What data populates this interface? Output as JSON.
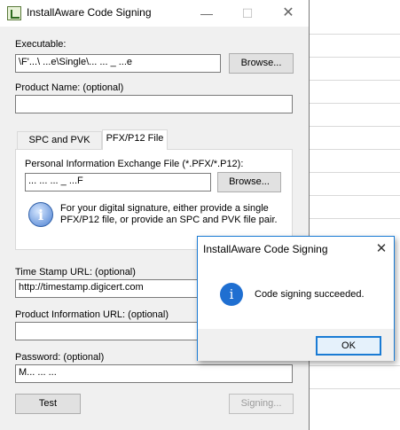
{
  "window": {
    "title": "InstallAware Code Signing",
    "minimize_glyph": "—",
    "maximize_glyph": "☐",
    "close_glyph": "✕"
  },
  "executable": {
    "label": "Executable:",
    "value": "\\F'...\\ ...e\\Single\\...  ...  _  ...e",
    "browse_label": "Browse..."
  },
  "product_name": {
    "label": "Product Name: (optional)",
    "value": ""
  },
  "tabs": [
    {
      "label": "SPC and PVK Files",
      "active": false
    },
    {
      "label": "PFX/P12 File",
      "active": true
    }
  ],
  "pfx": {
    "label": "Personal Information Exchange File (*.PFX/*.P12):",
    "value": "...  ... ... _ ...F",
    "browse_label": "Browse...",
    "info_icon": "info-icon",
    "info_text": "For your digital signature, either provide a single PFX/P12 file, or provide an SPC and PVK file pair."
  },
  "timestamp": {
    "label": "Time Stamp URL: (optional)",
    "value": "http://timestamp.digicert.com"
  },
  "product_info": {
    "label": "Product Information URL: (optional)",
    "value": ""
  },
  "password": {
    "label": "Password: (optional)",
    "value": "M...  ...  ..."
  },
  "buttons": {
    "test": "Test",
    "signing": "Signing..."
  },
  "dialog": {
    "title": "InstallAware Code Signing",
    "close_glyph": "✕",
    "icon": "info-icon",
    "message": "Code signing succeeded.",
    "ok_label": "OK"
  },
  "colors": {
    "accent": "#1a7bd4",
    "window_bg": "#f0f0f0",
    "info_blue": "#1f6fd1"
  }
}
